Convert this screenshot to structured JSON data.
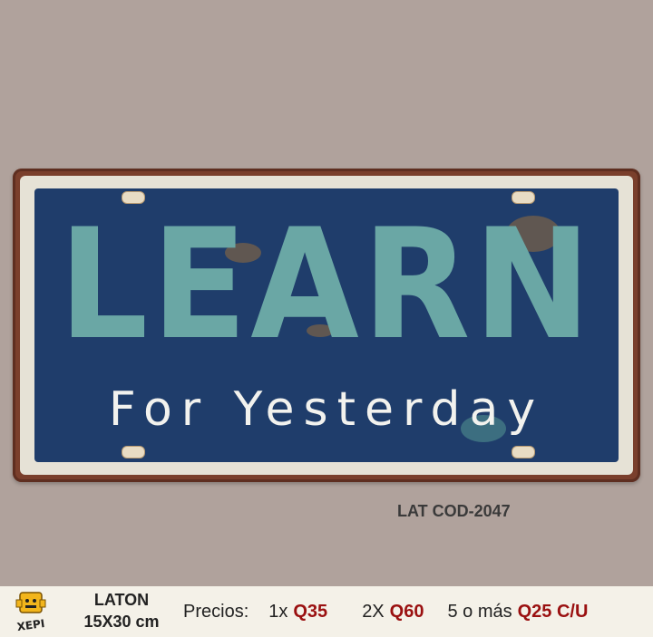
{
  "sign": {
    "headline": "LEARN",
    "subline": "For Yesterday",
    "colors": {
      "plate_blue": "#1f3d6b",
      "headline_teal": "#6aa7a5",
      "frame": "#e6e2d6",
      "rust_border": "#7a3f2c"
    }
  },
  "product_code": "LAT COD-2047",
  "footer": {
    "logo_text": "XEPI",
    "material": "LATON",
    "size": "15X30 cm",
    "prices_label": "Precios:",
    "tier1_qty": "1x",
    "tier1_price": "Q35",
    "tier2_qty": "2X",
    "tier2_price": "Q60",
    "tier3_qty": "5 o más",
    "tier3_price": "Q25 C/U",
    "price_color": "#9a1010"
  }
}
